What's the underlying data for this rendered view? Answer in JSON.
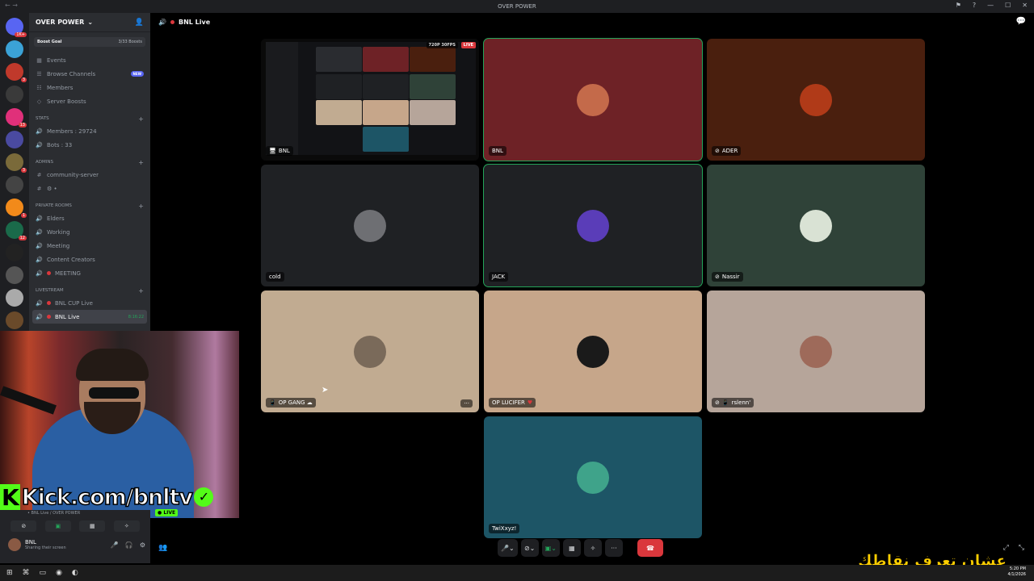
{
  "window": {
    "title": "OVER POWER",
    "nav_arrows": "← →",
    "controls": [
      "⚑",
      "?",
      "—",
      "☐",
      "✕"
    ]
  },
  "server": {
    "name": "OVER POWER",
    "boost_goal": {
      "label": "Boost Goal",
      "count": "3/33 Boosts"
    },
    "top_channels": [
      {
        "label": "Events",
        "icon": "calendar-icon"
      },
      {
        "label": "Browse Channels",
        "icon": "browse-icon",
        "badge": "NEW"
      },
      {
        "label": "Members",
        "icon": "members-icon"
      },
      {
        "label": "Server Boosts",
        "icon": "boost-icon"
      }
    ],
    "categories": [
      {
        "name": "STATS",
        "channels": [
          "Members : 29724",
          "Bots : 33"
        ]
      },
      {
        "name": "ADMINS",
        "channels": [
          "community-server",
          "⚙ •"
        ]
      },
      {
        "name": "PRIVATE ROOMS",
        "channels": [
          "Elders",
          "Working",
          "Meeting",
          "Content Creators",
          "MEETING"
        ]
      },
      {
        "name": "LIVESTREAM",
        "channels": [
          "BNL CUP Live",
          "BNL Live"
        ],
        "active_time": "8:16:22"
      }
    ]
  },
  "guild_badges": [
    "1K+",
    "",
    "3",
    "",
    "13",
    "",
    "3",
    "",
    "1",
    "12",
    "",
    "",
    "",
    "",
    "12",
    "1",
    ""
  ],
  "channel_header": {
    "name": "BNL Live"
  },
  "tiles": [
    {
      "name": "BNL",
      "stream_badge": "720P 30FPS",
      "live_badge": "LIVE",
      "icon": "screen-icon"
    },
    {
      "name": "BNL",
      "color": "#6e2226",
      "avatar_color": "#c46a4a",
      "speaking": true
    },
    {
      "name": "ADER",
      "color": "#4a1f0e",
      "avatar_color": "#b03a18",
      "icon": "mute-icon"
    },
    {
      "name": "cold",
      "color": "#1f2124",
      "avatar_color": "#6e6f73"
    },
    {
      "name": "JACK",
      "color": "#1f2124",
      "avatar_color": "#5a3db8",
      "speaking": true
    },
    {
      "name": "Nassir",
      "color": "#2f4238",
      "avatar_color": "#d9e2d4",
      "icon": "mute-icon"
    },
    {
      "name": "OP GANG ☁",
      "color": "#c1ab91",
      "avatar_color": "#7a6a5a",
      "icon": "phone-icon",
      "more": "···"
    },
    {
      "name": "OP LUCIFER",
      "color": "#c6a68a",
      "avatar_color": "#1a1a1a",
      "suffix": "♥"
    },
    {
      "name": "rslenn'",
      "color": "#b6a59a",
      "avatar_color": "#9e6a5a",
      "icon": "mute-icon"
    },
    {
      "name": "TwiXxyz!",
      "color": "#1d5566",
      "avatar_color": "#3fa38a"
    }
  ],
  "controls": [
    "🎤",
    "⌄",
    "⊘",
    "⌄",
    "▣",
    "⌄",
    "▦",
    "✧",
    "···",
    "☎"
  ],
  "overlay": {
    "kick_k": "K",
    "kick_text": "Kick.com/bnltv",
    "check": "✓",
    "live_badge": "● LIVE",
    "arabic": "عشان تعرف نقاطك"
  },
  "voice_panel": {
    "status": "• BNL Live / OVER POWER",
    "buttons": [
      "⊘",
      "▣",
      "▦",
      "✧"
    ],
    "user": {
      "name": "BNL",
      "sub": "Sharing their screen"
    },
    "icons": [
      "🎤",
      "🎧",
      "⚙"
    ]
  },
  "bottom_right": [
    "⤢",
    "⤡"
  ],
  "taskbar": {
    "icons": [
      "⊞",
      "⌘",
      "▭",
      "◉",
      "◐"
    ],
    "time": "5:20 PM",
    "date": "4/1/2026"
  }
}
